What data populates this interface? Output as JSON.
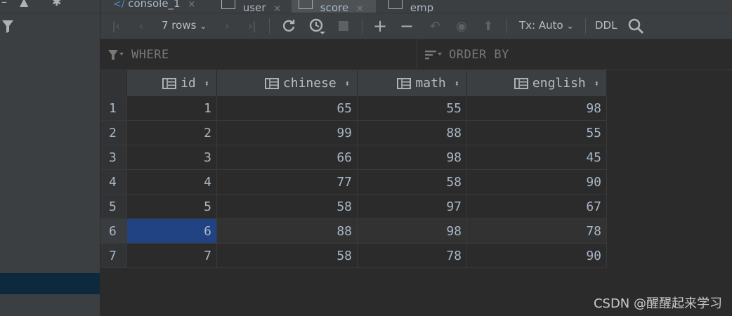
{
  "tabs": [
    {
      "label": "console_1",
      "active": false
    },
    {
      "label": "user",
      "active": false
    },
    {
      "label": "score",
      "active": true
    },
    {
      "label": "emp",
      "active": false
    }
  ],
  "toolbar": {
    "rows_label": "7 rows",
    "tx_label": "Tx: Auto",
    "ddl_label": "DDL"
  },
  "filter": {
    "where_label": "WHERE",
    "order_label": "ORDER BY"
  },
  "table": {
    "columns": [
      "id",
      "chinese",
      "math",
      "english"
    ],
    "rows": [
      {
        "num": "1",
        "cells": [
          "1",
          "65",
          "55",
          "98"
        ]
      },
      {
        "num": "2",
        "cells": [
          "2",
          "99",
          "88",
          "55"
        ]
      },
      {
        "num": "3",
        "cells": [
          "3",
          "66",
          "98",
          "45"
        ]
      },
      {
        "num": "4",
        "cells": [
          "4",
          "77",
          "58",
          "90"
        ]
      },
      {
        "num": "5",
        "cells": [
          "5",
          "58",
          "97",
          "67"
        ]
      },
      {
        "num": "6",
        "cells": [
          "6",
          "88",
          "98",
          "78"
        ]
      },
      {
        "num": "7",
        "cells": [
          "7",
          "58",
          "78",
          "90"
        ]
      }
    ],
    "selected_row": 6
  },
  "watermark": "CSDN @醒醒起来学习",
  "colors": {
    "background": "#2b2b2b",
    "panel": "#3c3f41",
    "selection": "#214283",
    "text": "#a9b7c6"
  },
  "icons": [
    "filter-icon",
    "refresh-icon",
    "history-icon",
    "stop-icon",
    "add-icon",
    "remove-icon",
    "revert-icon",
    "preview-icon",
    "submit-icon",
    "search-icon",
    "column-icon",
    "sort-icon"
  ]
}
